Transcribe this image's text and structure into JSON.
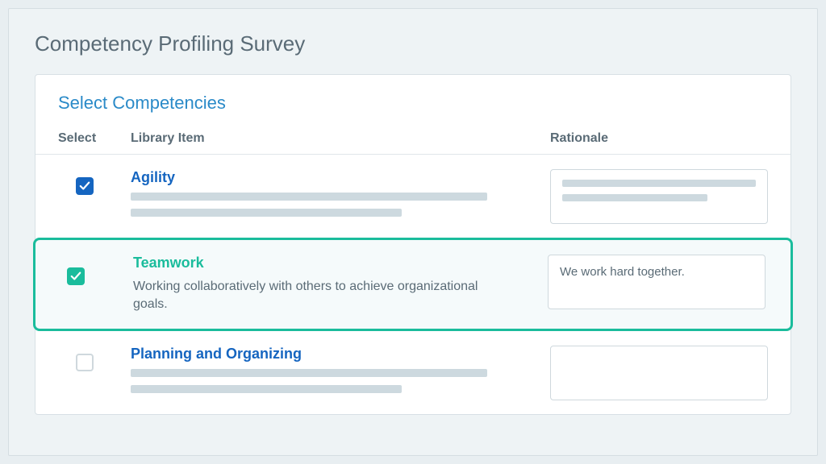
{
  "page": {
    "title": "Competency Profiling Survey"
  },
  "card": {
    "title": "Select Competencies"
  },
  "columns": {
    "select": "Select",
    "library": "Library Item",
    "rationale": "Rationale"
  },
  "rows": [
    {
      "checked": true,
      "title": "Agility",
      "description": "",
      "rationale": "",
      "highlighted": false,
      "checkbox_style": "blue"
    },
    {
      "checked": true,
      "title": "Teamwork",
      "description": "Working collaboratively with others to achieve organizational goals.",
      "rationale": "We work hard together.",
      "highlighted": true,
      "checkbox_style": "teal"
    },
    {
      "checked": false,
      "title": "Planning and Organizing",
      "description": "",
      "rationale": "",
      "highlighted": false,
      "checkbox_style": "none"
    }
  ]
}
